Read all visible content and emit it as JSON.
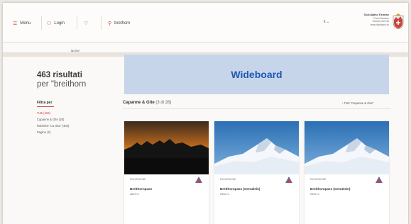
{
  "header": {
    "nav": [
      {
        "label": "Menu",
        "icon": "menu-icon"
      },
      {
        "label": "Login",
        "icon": "user-icon"
      },
      {
        "label": "",
        "icon": "heart-icon"
      },
      {
        "label": "brethorn",
        "icon": "search-icon"
      }
    ],
    "language": "it",
    "club": {
      "name": "Club Alpino Ticinese",
      "lines": [
        "Corso Svizzero",
        "Sezione del CAI",
        "www.clubalpino.ch"
      ]
    }
  },
  "subnav": {
    "label": "Home"
  },
  "sidebar": {
    "results_count": "463 risultati",
    "query": "per \"breithorn",
    "filter_heading": "Filtra per",
    "filters": [
      {
        "label": "Tutti (463)",
        "active": true
      },
      {
        "label": "Capanne & Gite (28)",
        "active": false
      },
      {
        "label": "Rubriche \"La Gita\" (403)",
        "active": false
      },
      {
        "label": "Pagine (2)",
        "active": false
      }
    ]
  },
  "wideboard": {
    "label": "Wideboard"
  },
  "section": {
    "title": "Capanne & Gite",
    "count": "(3 di 28)",
    "link_label": "Tutti \"Capanne & Gite\""
  },
  "cards": [
    {
      "kind": "ESCURSIONE",
      "title": "Breithornpass",
      "altitude": "2819 m",
      "photo": "sunset"
    },
    {
      "kind": "ESCURSIONE",
      "title": "Breithornpass (Grenzlein)",
      "altitude": "2932 m",
      "photo": "snow"
    },
    {
      "kind": "ESCURSIONE",
      "title": "Breithornpass (Grenzlein)",
      "altitude": "2932 m",
      "photo": "snow"
    }
  ],
  "colors": {
    "accent": "#c8443a",
    "wideboard_bg": "#c7d5ea",
    "wideboard_text": "#1e59b4"
  }
}
